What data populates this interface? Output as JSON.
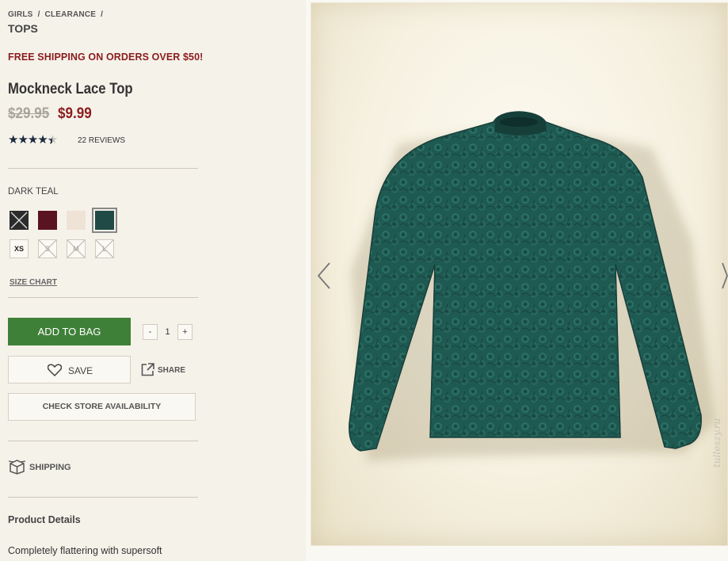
{
  "breadcrumb": {
    "items": [
      "GIRLS",
      "CLEARANCE"
    ],
    "separator": "/",
    "current": "TOPS"
  },
  "promo": "FREE SHIPPING ON ORDERS OVER $50!",
  "product": {
    "title": "Mockneck Lace Top",
    "price_original": "$29.95",
    "price_sale": "$9.99",
    "rating": 4.5,
    "reviews": "22 REVIEWS",
    "color_name": "DARK TEAL",
    "swatches": [
      {
        "name": "black",
        "color": "#2b2b2b",
        "available": false
      },
      {
        "name": "burgundy",
        "color": "#5a1420",
        "available": true
      },
      {
        "name": "cream",
        "color": "#efe3d6",
        "available": true
      },
      {
        "name": "dark-teal",
        "color": "#1f4a45",
        "available": true,
        "selected": true
      }
    ],
    "sizes": [
      {
        "label": "XS",
        "available": true
      },
      {
        "label": "S",
        "available": false
      },
      {
        "label": "M",
        "available": false
      },
      {
        "label": "L",
        "available": false
      }
    ],
    "size_chart": "SIZE CHART"
  },
  "actions": {
    "add_to_bag": "ADD TO BAG",
    "qty_minus": "-",
    "qty": "1",
    "qty_plus": "+",
    "save": "SAVE",
    "share": "SHARE",
    "check_store": "CHECK STORE AVAILABILITY",
    "shipping": "SHIPPING"
  },
  "details": {
    "heading": "Product Details",
    "text": "Completely flattering with supersoft"
  },
  "gallery": {
    "watermark": "tulleszy.ru"
  },
  "colors": {
    "accent_red": "#8b1c1c",
    "add_green": "#3f8038",
    "garment_teal": "#1f5a52"
  }
}
